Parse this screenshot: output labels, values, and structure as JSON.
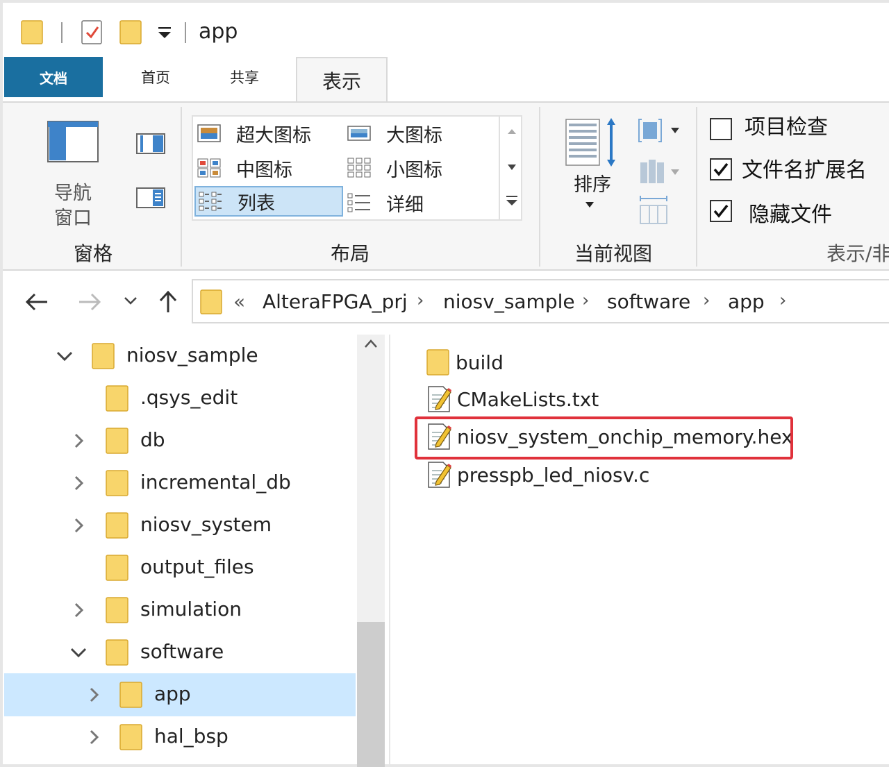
{
  "window": {
    "title": "app"
  },
  "ribbon": {
    "tabs": {
      "file": "文档",
      "home": "首页",
      "share": "共享",
      "view": "表示"
    },
    "panes": {
      "nav_pane_line1": "导航",
      "nav_pane_line2": "窗口",
      "group": "窗格"
    },
    "layout": {
      "items": [
        "超大图标",
        "大图标",
        "中图标",
        "小图标",
        "列表",
        "详细"
      ],
      "selected": "列表",
      "group": "布局"
    },
    "current_view": {
      "sort": "排序",
      "group": "当前视图"
    },
    "show_hide": {
      "item_check": "项目检查",
      "file_ext": "文件名扩展名",
      "hidden": "隐藏文件",
      "item_check_checked": false,
      "file_ext_checked": true,
      "hidden_checked": true,
      "group": "表示/非"
    }
  },
  "address": {
    "overflow": "«",
    "crumbs": [
      "AlteraFPGA_prj",
      "niosv_sample",
      "software",
      "app"
    ]
  },
  "tree": [
    {
      "label": "niosv_sample",
      "state": "expanded"
    },
    {
      "label": ".qsys_edit",
      "state": "none"
    },
    {
      "label": "db",
      "state": "collapsed"
    },
    {
      "label": "incremental_db",
      "state": "collapsed"
    },
    {
      "label": "niosv_system",
      "state": "collapsed"
    },
    {
      "label": "output_files",
      "state": "none"
    },
    {
      "label": "simulation",
      "state": "collapsed"
    },
    {
      "label": "software",
      "state": "expanded"
    },
    {
      "label": "app",
      "state": "collapsed",
      "selected": true
    },
    {
      "label": "hal_bsp",
      "state": "collapsed"
    }
  ],
  "files": [
    {
      "name": "build",
      "type": "folder"
    },
    {
      "name": "CMakeLists.txt",
      "type": "text"
    },
    {
      "name": "niosv_system_onchip_memory.hex",
      "type": "text",
      "highlighted": true
    },
    {
      "name": "presspb_led_niosv.c",
      "type": "text"
    }
  ],
  "colors": {
    "accent": "#1a6fa0",
    "selection": "#cce8ff",
    "highlight": "#e0313b",
    "folder": "#f8d56b"
  }
}
